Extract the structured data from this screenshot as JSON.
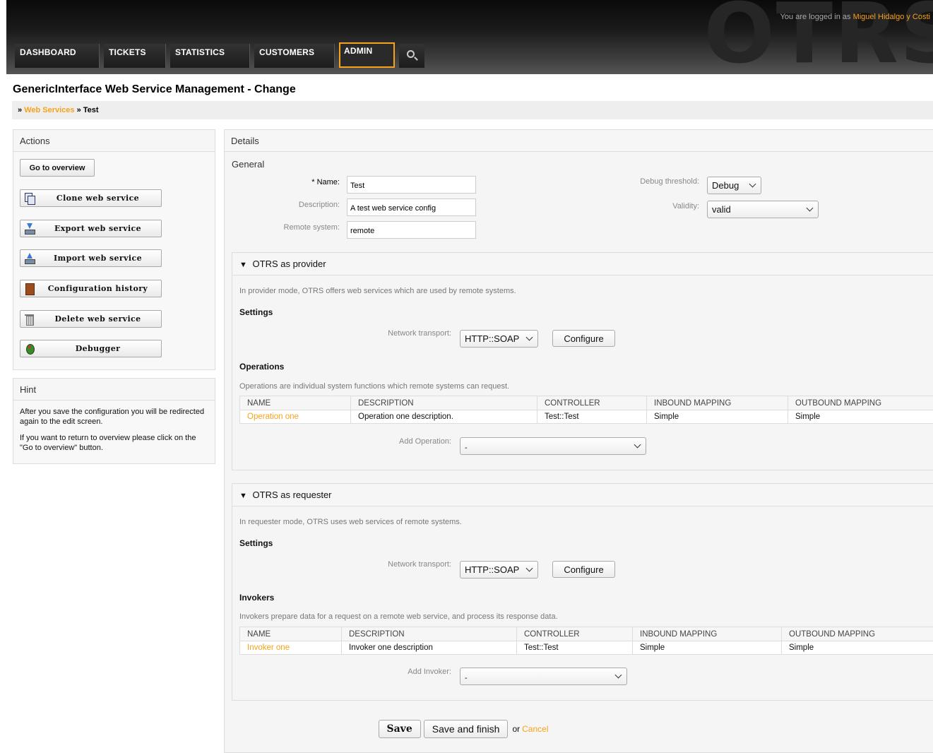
{
  "header": {
    "logo": "OTRS",
    "logged_in_prefix": "You are logged in as",
    "logged_in_user": "Miguel Hidalgo y Costi",
    "nav": [
      "DASHBOARD",
      "TICKETS",
      "STATISTICS",
      "CUSTOMERS",
      "ADMIN"
    ],
    "active_nav": "ADMIN"
  },
  "page_title": "GenericInterface Web Service Management - Change",
  "breadcrumb": {
    "sep": "»",
    "link": "Web Services",
    "current": "Test"
  },
  "sidebar": {
    "actions_title": "Actions",
    "go_to_overview": "Go to overview",
    "buttons": [
      {
        "label": "Clone web service",
        "icon": "clone-icon"
      },
      {
        "label": "Export web service",
        "icon": "export-icon"
      },
      {
        "label": "Import web service",
        "icon": "import-icon"
      },
      {
        "label": "Configuration history",
        "icon": "history-icon"
      },
      {
        "label": "Delete web service",
        "icon": "trash-icon"
      },
      {
        "label": "Debugger",
        "icon": "bug-icon"
      }
    ],
    "hint_title": "Hint",
    "hint_paragraphs": [
      "After you save the configuration you will be redirected again to the edit screen.",
      "If you want to return to overview please click on the \"Go to overview\" button."
    ]
  },
  "details": {
    "title": "Details",
    "general_title": "General",
    "name_label": "* Name:",
    "name_value": "Test",
    "description_label": "Description:",
    "description_value": "A test web service config",
    "remote_label": "Remote system:",
    "remote_value": "remote",
    "debug_label": "Debug threshold:",
    "debug_value": "Debug",
    "validity_label": "Validity:",
    "validity_value": "valid"
  },
  "provider": {
    "title": "OTRS as provider",
    "intro": "In provider mode, OTRS offers web services which are used by remote systems.",
    "settings_title": "Settings",
    "transport_label": "Network transport:",
    "transport_value": "HTTP::SOAP",
    "configure_label": "Configure",
    "ops_title": "Operations",
    "ops_intro": "Operations are individual system functions which remote systems can request.",
    "columns": [
      "NAME",
      "DESCRIPTION",
      "CONTROLLER",
      "INBOUND MAPPING",
      "OUTBOUND MAPPING"
    ],
    "rows": [
      [
        "Operation one",
        "Operation one description.",
        "Test::Test",
        "Simple",
        "Simple"
      ]
    ],
    "add_label": "Add Operation:",
    "add_value": "-"
  },
  "requester": {
    "title": "OTRS as requester",
    "intro": "In requester mode, OTRS uses web services of remote systems.",
    "settings_title": "Settings",
    "transport_label": "Network transport:",
    "transport_value": "HTTP::SOAP",
    "configure_label": "Configure",
    "inv_title": "Invokers",
    "inv_intro": "Invokers prepare data for a request on a remote web service, and process its response data.",
    "columns": [
      "NAME",
      "DESCRIPTION",
      "CONTROLLER",
      "INBOUND MAPPING",
      "OUTBOUND MAPPING"
    ],
    "rows": [
      [
        "Invoker one",
        "Invoker one description",
        "Test::Test",
        "Simple",
        "Simple"
      ]
    ],
    "add_label": "Add Invoker:",
    "add_value": "-"
  },
  "footer": {
    "save": "Save",
    "save_finish": "Save and finish",
    "or": "or",
    "cancel": "Cancel"
  },
  "colors": {
    "accent": "#f7a21a",
    "header_dark": "#1a1a1a"
  }
}
